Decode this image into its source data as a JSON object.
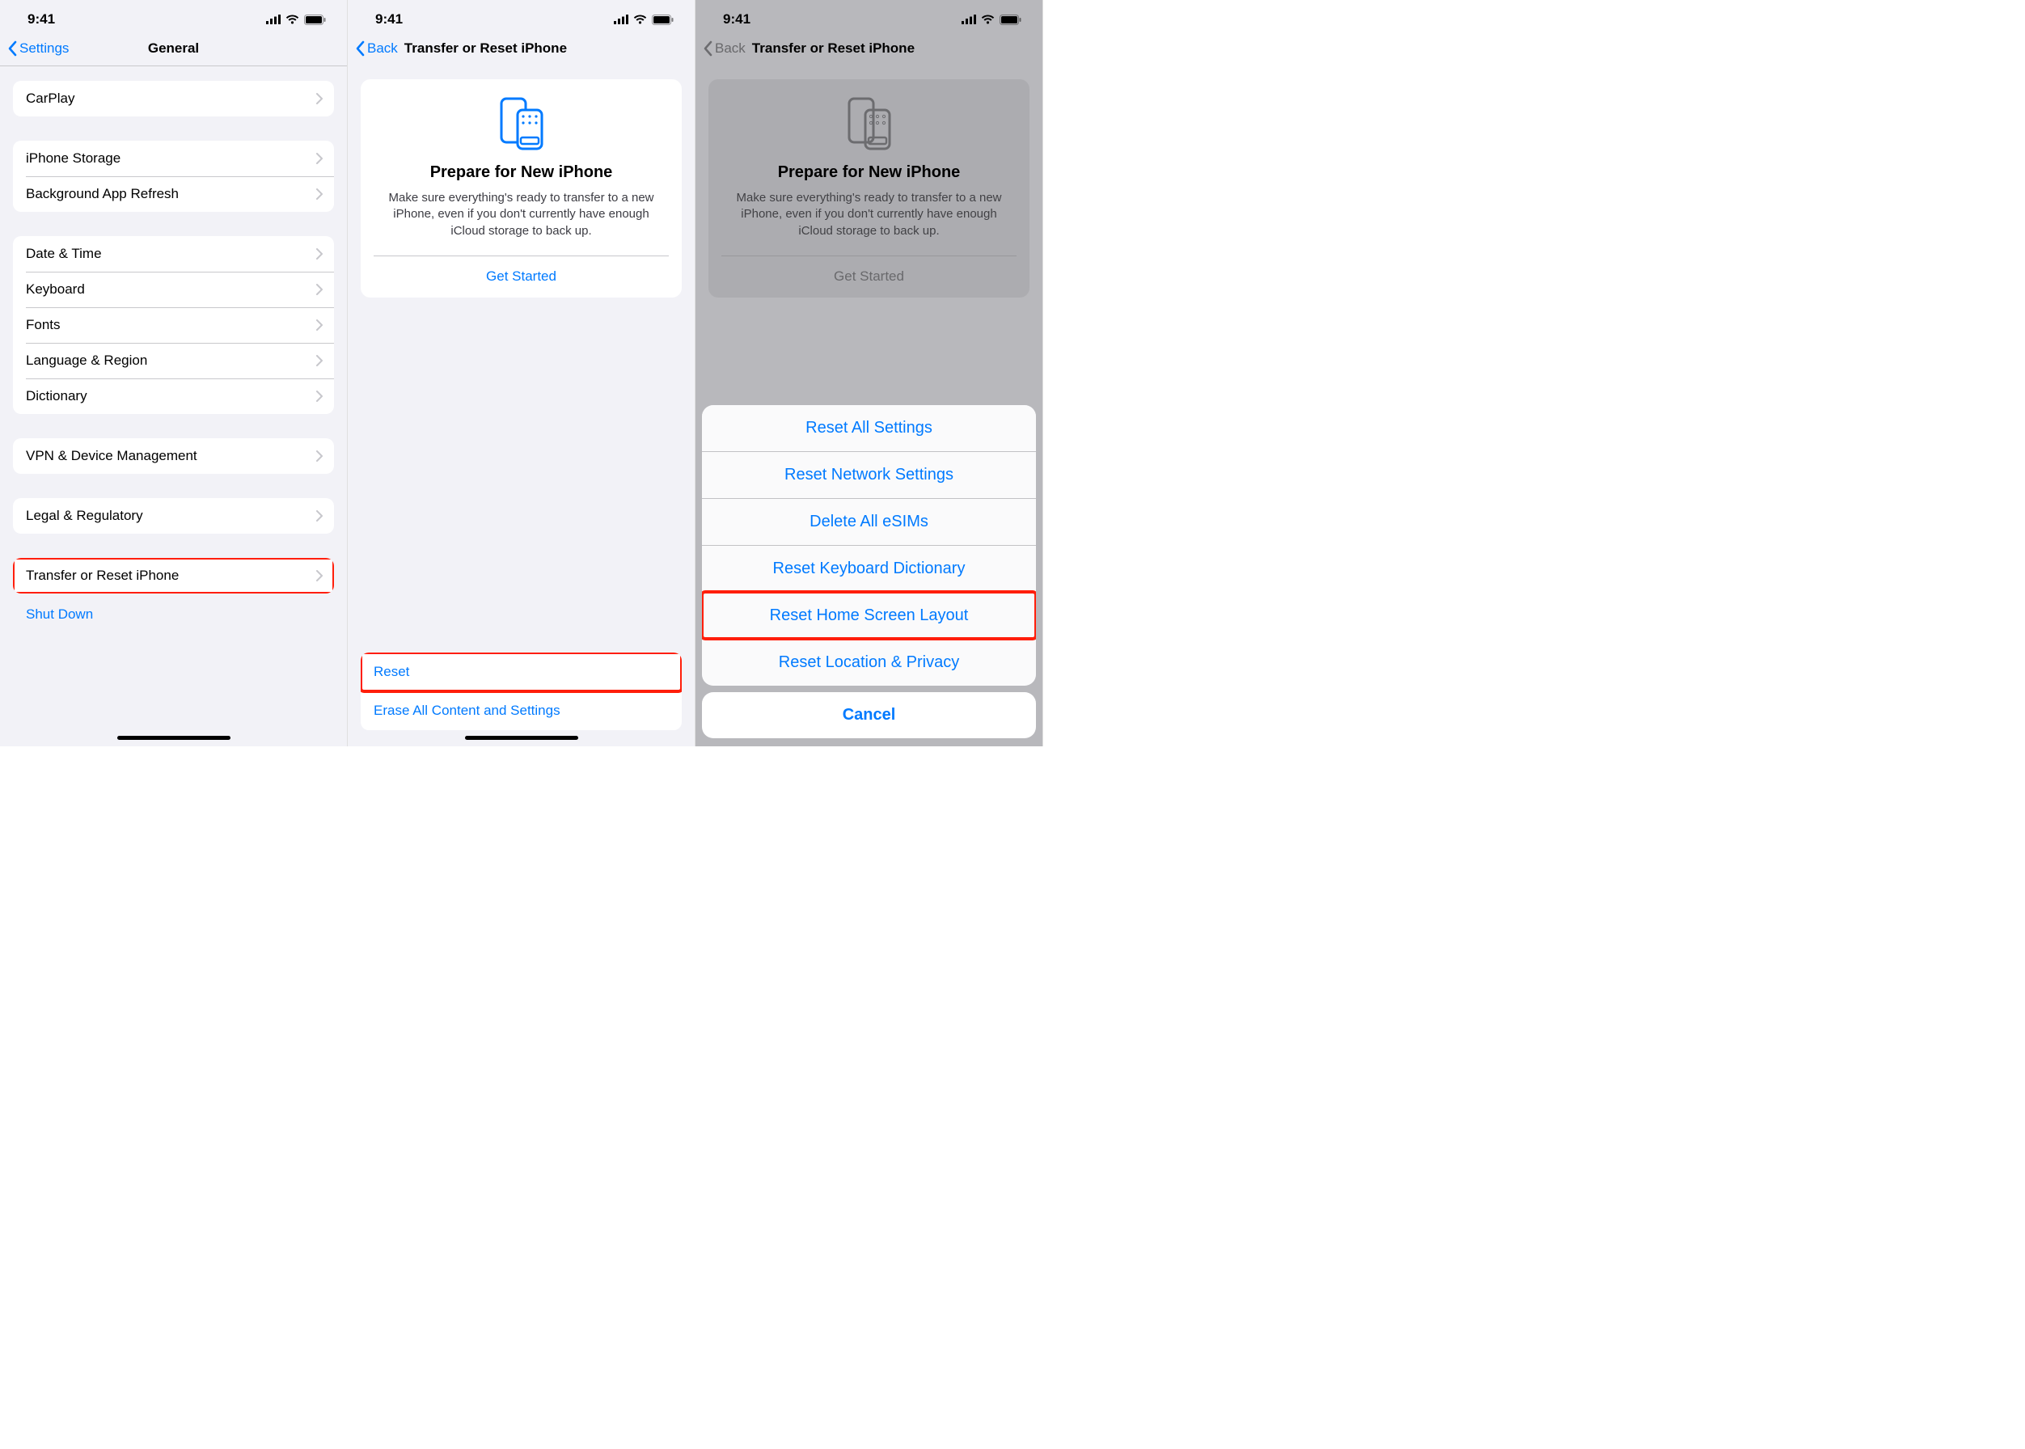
{
  "status": {
    "time": "9:41"
  },
  "panel1": {
    "back": "Settings",
    "title": "General",
    "groups": [
      {
        "items": [
          {
            "label": "CarPlay"
          }
        ]
      },
      {
        "items": [
          {
            "label": "iPhone Storage"
          },
          {
            "label": "Background App Refresh"
          }
        ]
      },
      {
        "items": [
          {
            "label": "Date & Time"
          },
          {
            "label": "Keyboard"
          },
          {
            "label": "Fonts"
          },
          {
            "label": "Language & Region"
          },
          {
            "label": "Dictionary"
          }
        ]
      },
      {
        "items": [
          {
            "label": "VPN & Device Management"
          }
        ]
      },
      {
        "items": [
          {
            "label": "Legal & Regulatory"
          }
        ]
      },
      {
        "items": [
          {
            "label": "Transfer or Reset iPhone",
            "highlight": true
          }
        ]
      }
    ],
    "shutdown": "Shut Down"
  },
  "panel2": {
    "back": "Back",
    "title": "Transfer or Reset iPhone",
    "card": {
      "heading": "Prepare for New iPhone",
      "body": "Make sure everything's ready to transfer to a new iPhone, even if you don't currently have enough iCloud storage to back up.",
      "action": "Get Started"
    },
    "bottom": [
      {
        "label": "Reset",
        "highlight": true
      },
      {
        "label": "Erase All Content and Settings"
      }
    ]
  },
  "panel3": {
    "back": "Back",
    "title": "Transfer or Reset iPhone",
    "card": {
      "heading": "Prepare for New iPhone",
      "body": "Make sure everything's ready to transfer to a new iPhone, even if you don't currently have enough iCloud storage to back up.",
      "action": "Get Started"
    },
    "sheet": {
      "options": [
        "Reset All Settings",
        "Reset Network Settings",
        "Delete All eSIMs",
        "Reset Keyboard Dictionary",
        "Reset Home Screen Layout",
        "Reset Location & Privacy"
      ],
      "highlightIndex": 4,
      "cancel": "Cancel"
    }
  }
}
